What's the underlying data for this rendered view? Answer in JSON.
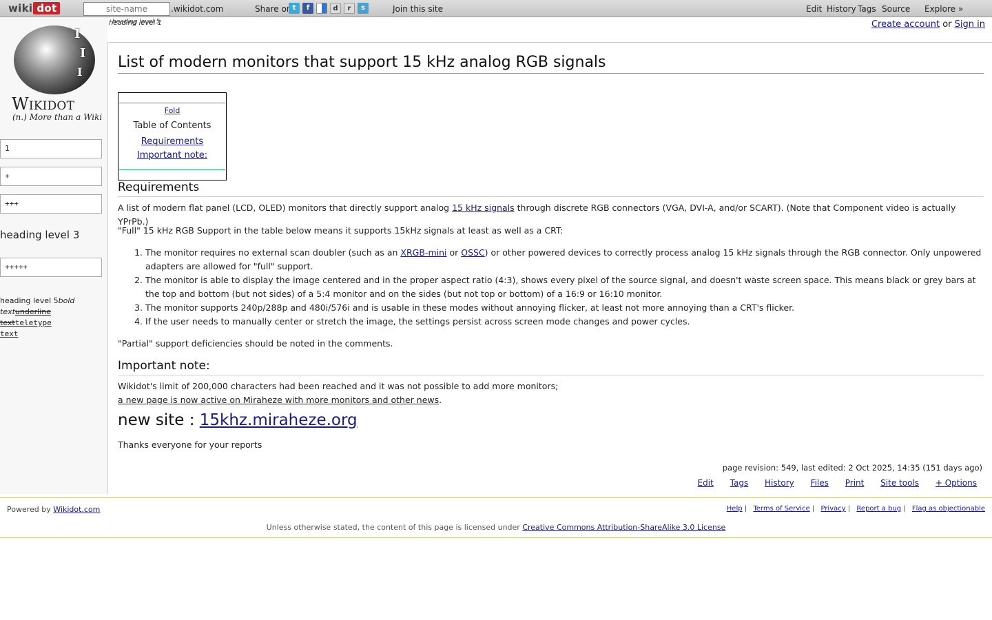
{
  "topbar": {
    "logo_part1": "wiki",
    "logo_part2": "dot",
    "site_placeholder": "site-name",
    "site_suffix": ".wikidot.com",
    "share_label": "Share on",
    "share_icons": [
      "twitter-icon",
      "facebook-icon",
      "delicious-icon",
      "digg-icon",
      "reddit-icon",
      "stumbleupon-icon"
    ],
    "join_label": "Join this site",
    "nav": {
      "edit": "Edit",
      "history": "History",
      "tags": "Tags",
      "source": "Source",
      "explore": "Explore »"
    }
  },
  "overlay": {
    "heading5": "heading level 5",
    "heading1": "heading level 1"
  },
  "login": {
    "create": "Create account",
    "or": "or",
    "signin": "Sign in"
  },
  "sidebar": {
    "brand": "Wikidot",
    "brand_sub": "(n.) More than a Wiki",
    "boxes": [
      "1",
      "+",
      "+++",
      "+++++"
    ],
    "heading3": "heading level 3",
    "misc_h5": "heading level 5",
    "misc_bold": "bold",
    "misc_italic": "text",
    "misc_underline": "underline text",
    "misc_tt1": "teletype",
    "misc_tt2": "text"
  },
  "content": {
    "title": "List of modern monitors that support 15 kHz analog RGB signals",
    "toc": {
      "fold": "Fold",
      "title": "Table of Contents",
      "items": [
        "Requirements",
        "Important note:"
      ]
    },
    "sec1": "Requirements",
    "p1_a": "A list of modern flat panel (LCD, OLED) monitors that directly support analog ",
    "p1_link": "15 kHz signals",
    "p1_b": " through discrete RGB connectors (VGA, DVI-A, and/or SCART). (Note that Component video is actually YPrPb.)",
    "p2": "\"Full\" 15 kHz RGB Support in the table below means it supports 15kHz signals at least as well as a CRT:",
    "li1_a": "The monitor requires no external scan doubler (such as an ",
    "li1_link1": "XRGB-mini",
    "li1_or": " or ",
    "li1_link2": "OSSC",
    "li1_b": ") or other powered devices to correctly process analog 15 kHz signals through the RGB connector. Only unpowered adapters are allowed for \"full\" support.",
    "li2": "The monitor is able to display the image centered and in the proper aspect ratio (4:3), shows every pixel of the source signal, and doesn't waste screen space. This means black or grey bars at the top and bottom (but not sides) of a 5:4 monitor and on the sides (but not top or bottom) of a 16:9 or 16:10 monitor.",
    "li3": "The monitor supports 240p/288p and 480i/576i and is usable in these modes without annoying flicker, at least not more annoying than a CRT's flicker.",
    "li4": "If the user needs to manually center or stretch the image, the settings persist across screen mode changes and power cycles.",
    "p3": "\"Partial\" support deficiencies should be noted in the comments.",
    "sec2": "Important note:",
    "p4": "Wikidot's limit of 200,000 characters had been reached and it was not possible to add more monitors;",
    "p5_link": "a new page is now active on Miraheze with more monitors and other news",
    "p5_end": ".",
    "newsite_label": "new site : ",
    "newsite_link": "15khz.miraheze.org",
    "thanks": "Thanks everyone for your reports",
    "revision": "page revision: 549, last edited: 2 Oct 2025, 14:35 (151 days ago)",
    "options": {
      "edit": "Edit",
      "tags": "Tags",
      "history": "History",
      "files": "Files",
      "print": "Print",
      "sitetools": "Site tools",
      "more": "+ Options"
    }
  },
  "footer": {
    "powered": "Powered by ",
    "powered_link": "Wikidot.com",
    "links": {
      "help": "Help",
      "tos": "Terms of Service",
      "privacy": "Privacy",
      "bug": "Report a bug",
      "flag": "Flag as objectionable"
    },
    "license_text": "Unless otherwise stated, the content of this page is licensed under ",
    "license_link": "Creative Commons Attribution-ShareAlike 3.0 License"
  }
}
